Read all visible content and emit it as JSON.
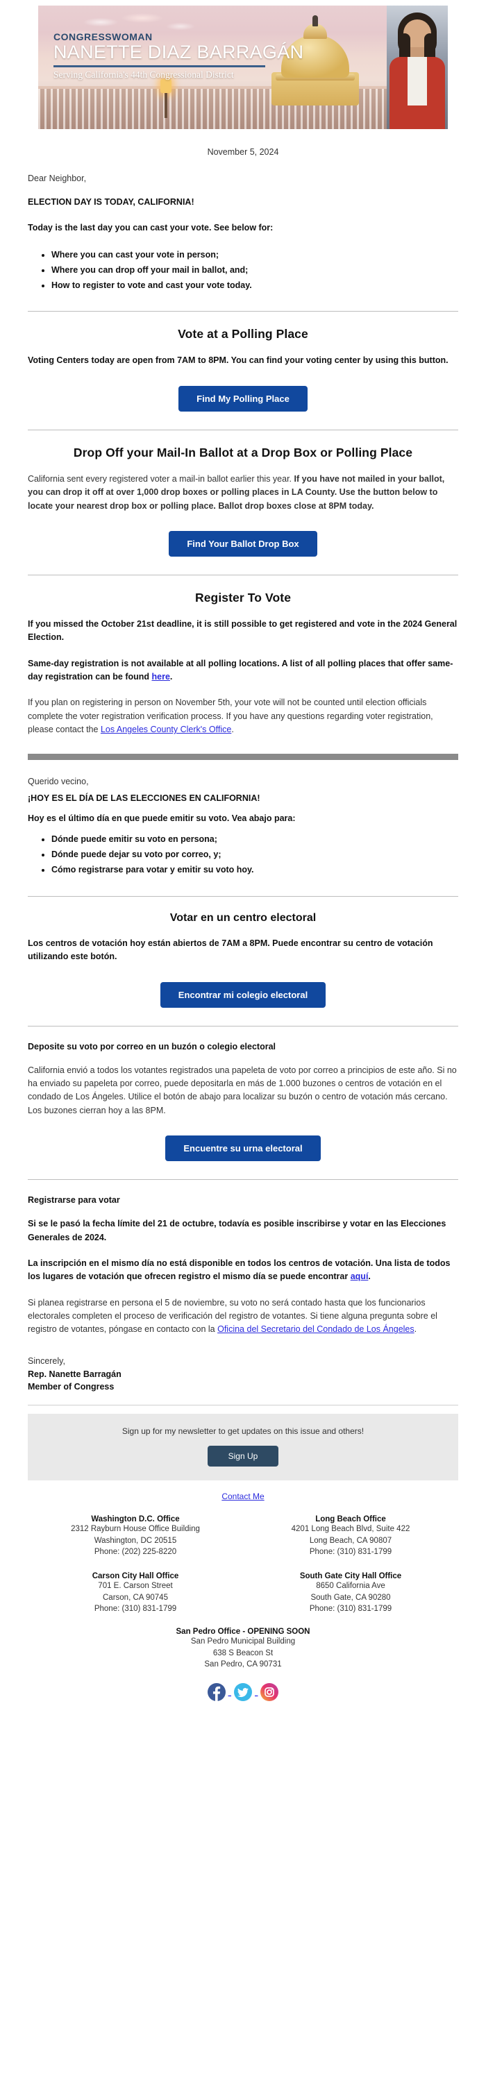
{
  "banner": {
    "kicker": "CONGRESSWOMAN",
    "name": "NANETTE DIAZ BARRAGÁN",
    "subtitle": "Serving California's 44th Congressional District",
    "photo_alt": "portrait-of-congresswoman"
  },
  "date": "November 5, 2024",
  "english": {
    "salutation": "Dear Neighbor,",
    "headline": "ELECTION DAY IS TODAY, CALIFORNIA!",
    "intro": "Today is the last day you can cast your vote.  See below for:",
    "bullets": [
      "Where you can cast your vote in person;",
      "Where you can drop off your mail in ballot, and;",
      "How to register to vote and cast your vote today."
    ],
    "polling": {
      "heading": "Vote at a Polling Place",
      "body": "Voting Centers today are open from 7AM to 8PM.  You can find your voting center by using this button.",
      "button": "Find My Polling Place"
    },
    "dropoff": {
      "heading": "Drop Off your Mail-In Ballot at a Drop Box or Polling Place",
      "body_normal": "California sent every registered voter a mail-in ballot earlier this year.  ",
      "body_bold": "If you have not mailed in your ballot, you can drop it off at over 1,000 drop boxes or polling places in LA County.  Use the button below to locate your nearest drop box or polling place. Ballot drop boxes close at 8PM today.",
      "button": "Find Your Ballot Drop Box"
    },
    "register": {
      "heading": "Register To Vote",
      "para1": "If you missed the October 21st deadline, it is still possible to get registered and vote in the 2024 General Election.",
      "para2_a": "Same-day registration is not available at all polling locations. A list of all polling places that offer same-day registration can be found ",
      "para2_link": "here",
      "para2_b": ".",
      "para3_a": "If you plan on registering in person on November 5th, your vote will not be counted until election officials complete the voter registration verification process. If you have any questions regarding voter registration, please contact the ",
      "para3_link": "Los Angeles County Clerk's Office",
      "para3_b": "."
    }
  },
  "spanish": {
    "salutation": "Querido vecino,",
    "headline": "¡HOY ES EL DÍA DE LAS ELECCIONES EN CALIFORNIA!",
    "intro": "Hoy es el último día en que puede emitir su voto. Vea abajo para:",
    "bullets": [
      "Dónde puede emitir su voto en persona;",
      "Dónde puede dejar su voto por correo, y;",
      "Cómo registrarse para votar y emitir su voto hoy."
    ],
    "polling": {
      "heading": "Votar en un centro electoral",
      "body": "Los centros de votación hoy están abiertos de 7AM a 8PM. Puede encontrar su centro de votación utilizando este botón.",
      "button": "Encontrar mi colegio electoral"
    },
    "dropoff": {
      "heading": "Deposite su voto por correo en un buzón o colegio electoral",
      "body": "California envió a todos los votantes registrados una papeleta de voto por correo a principios de este año. Si no ha enviado su papeleta por correo, puede depositarla en más de 1.000 buzones o centros de votación en el condado de Los Ángeles. Utilice el botón de abajo para localizar su buzón o centro de votación más cercano. Los buzones cierran hoy a las 8PM.",
      "button": "Encuentre su urna electoral"
    },
    "register": {
      "heading": "Registrarse para votar",
      "para1": "Si se le pasó la fecha límite del 21 de octubre, todavía es posible inscribirse y votar en las Elecciones Generales de 2024.",
      "para2_a": "La inscripción en el mismo día no está disponible en todos los centros de votación. Una lista de todos los lugares de votación que ofrecen registro el mismo día se puede encontrar ",
      "para2_link": "aquí",
      "para2_b": ".",
      "para3_a": "Si planea registrarse en persona el 5 de noviembre, su voto no será contado hasta que los funcionarios electorales completen el proceso de verificación del registro de votantes. Si tiene alguna pregunta sobre el registro de votantes, póngase en contacto con la ",
      "para3_link": "Oficina del Secretario del Condado de Los Ángeles",
      "para3_b": "."
    }
  },
  "signoff": {
    "line1": "Sincerely,",
    "line2": "Rep. Nanette Barragán",
    "line3": "Member of Congress"
  },
  "footer": {
    "signup_text": "Sign up for my newsletter to get updates on this issue and others!",
    "signup_button": "Sign Up",
    "contact_link": "Contact Me",
    "offices": [
      {
        "name": "Washington D.C. Office",
        "lines": [
          "2312 Rayburn House Office Building",
          "Washington, DC 20515",
          "Phone: (202) 225-8220"
        ]
      },
      {
        "name": "Long Beach Office",
        "lines": [
          "4201 Long Beach Blvd, Suite 422",
          "Long Beach, CA 90807",
          "Phone: (310) 831-1799"
        ]
      },
      {
        "name": "Carson City Hall Office",
        "lines": [
          "701 E. Carson Street",
          "Carson, CA 90745",
          "Phone: (310) 831-1799"
        ]
      },
      {
        "name": "South Gate City Hall Office",
        "lines": [
          "8650 California Ave",
          "South Gate, CA 90280",
          "Phone: (310) 831-1799"
        ]
      }
    ],
    "office_single": {
      "name": "San Pedro Office - OPENING SOON",
      "lines": [
        "San Pedro Municipal Building",
        "638 S Beacon St",
        "San Pedro, CA 90731"
      ]
    },
    "social": [
      {
        "name": "facebook-icon",
        "color": "#3b5998"
      },
      {
        "name": "twitter-icon",
        "color": "#3ab8e8"
      },
      {
        "name": "instagram-icon",
        "color": "#d6336c"
      }
    ]
  },
  "colors": {
    "primary_button": "#11489E",
    "signup_button": "#2e4a63",
    "link": "#2b2bdd",
    "gray_divider": "#8a8a8a",
    "signup_bg": "#e9e9e9"
  }
}
